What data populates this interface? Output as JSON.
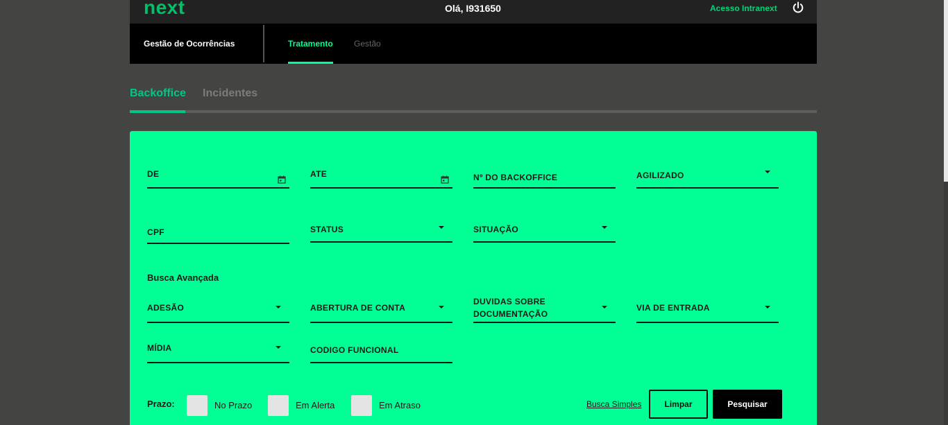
{
  "header": {
    "logo": "next",
    "greeting": "Olá, I931650",
    "intranext_link": "Acesso Intranext",
    "power_icon": "power-icon"
  },
  "nav": {
    "section": "Gestão de Ocorrências",
    "tabs": [
      {
        "label": "Tratamento",
        "active": true
      },
      {
        "label": "Gestão",
        "active": false
      }
    ]
  },
  "subtabs": [
    {
      "label": "Backoffice",
      "active": true
    },
    {
      "label": "Incidentes",
      "active": false
    }
  ],
  "form": {
    "fields": {
      "de": "DE",
      "ate": "ATE",
      "numero_backoffice": "Nº DO BACKOFFICE",
      "agilizado": "AGILIZADO",
      "cpf": "CPF",
      "status": "STATUS",
      "situacao": "SITUAÇÃO",
      "adesao": "ADESÃO",
      "abertura_conta": "ABERTURA DE CONTA",
      "duvidas_documentacao": "DUVIDAS SOBRE DOCUMENTAÇÃO",
      "via_entrada": "VIA DE ENTRADA",
      "midia": "MÍDIA",
      "codigo_funcional": "CODIGO FUNCIONAL"
    },
    "advanced_title": "Busca Avançada",
    "prazo": {
      "label": "Prazo:",
      "options": [
        "No Prazo",
        "Em Alerta",
        "Em Atraso"
      ]
    },
    "busca_simples": "Busca Simples",
    "limpar": "Limpar",
    "pesquisar": "Pesquisar"
  },
  "colors": {
    "accent": "#00ff94",
    "logo_green": "#00c16a",
    "background": "#444442",
    "panel": "#00ff94"
  }
}
